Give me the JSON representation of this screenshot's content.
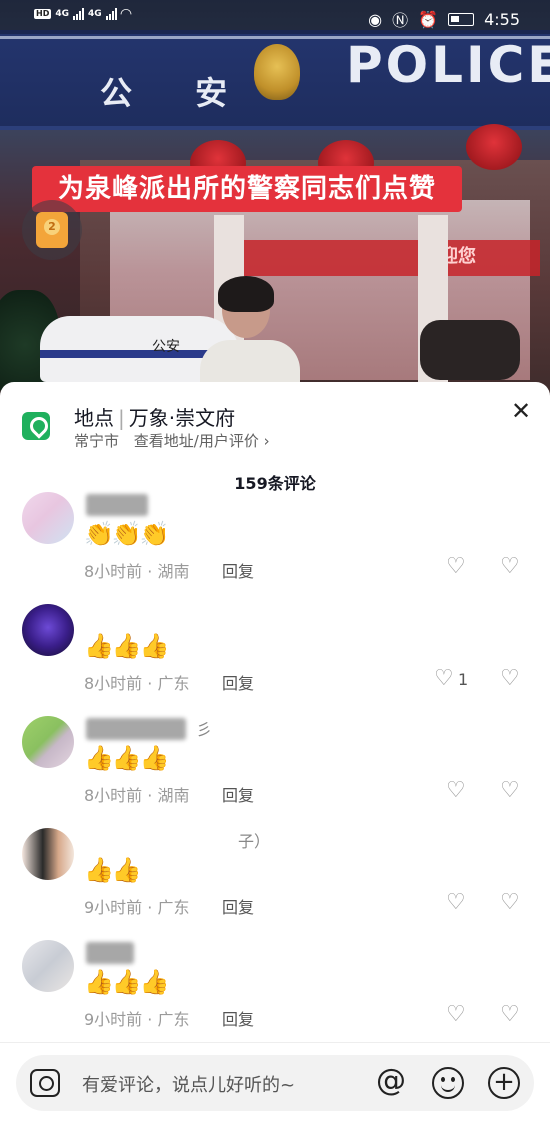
{
  "status_bar": {
    "time": "4:55",
    "network": "4G"
  },
  "video": {
    "sign_cn": "公 安",
    "sign_en": "POLICE",
    "caption": "为泉峰派出所的警察同志们点赞",
    "car_label": "公安",
    "led_text": "迎您",
    "redpacket_count": "2"
  },
  "location": {
    "label": "地点",
    "name": "万象·崇文府",
    "city": "常宁市",
    "link_text": "查看地址/用户评价 ›"
  },
  "comment_count": "159条评论",
  "comments": [
    {
      "name": "",
      "emojis": "👏👏👏",
      "meta": "8小时前 · 湖南",
      "reply": "回复",
      "likes": ""
    },
    {
      "name": "",
      "emojis": "👍👍👍",
      "meta": "8小时前 · 广东",
      "reply": "回复",
      "likes": "1"
    },
    {
      "name": "彡",
      "emojis": "👍👍👍",
      "meta": "8小时前 · 湖南",
      "reply": "回复",
      "likes": ""
    },
    {
      "name": "子）",
      "emojis": "👍👍",
      "meta": "9小时前 · 广东",
      "reply": "回复",
      "likes": ""
    },
    {
      "name": "",
      "emojis": "👍👍👍",
      "meta": "9小时前 · 广东",
      "reply": "回复",
      "likes": ""
    }
  ],
  "input": {
    "placeholder": "有爱评论，说点儿好听的~"
  },
  "icons": {
    "like": "heart-outline-icon",
    "dislike": "broken-heart-icon",
    "camera": "camera-icon",
    "mention": "at-icon",
    "emoji": "smiley-icon",
    "more": "plus-icon"
  },
  "colors": {
    "accent_green": "#1fb05d",
    "caption_red": "#e4323c"
  }
}
